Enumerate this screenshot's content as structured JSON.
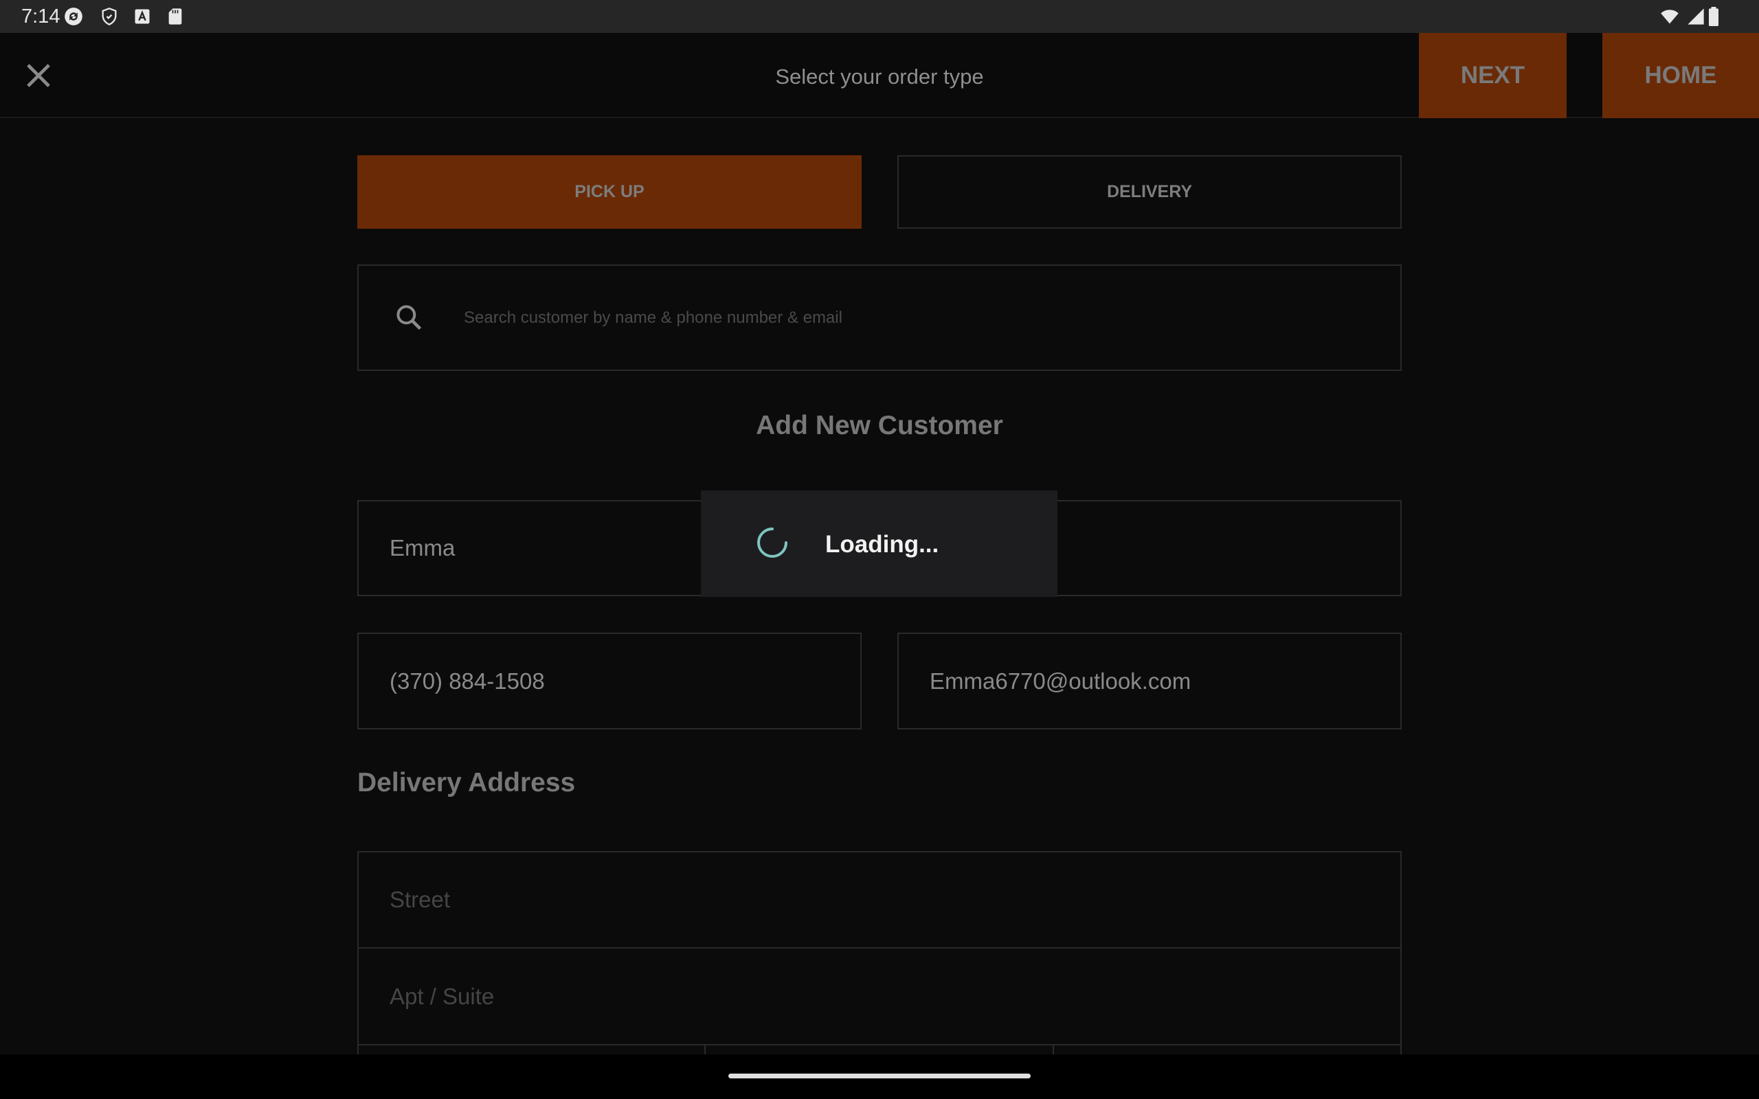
{
  "status_bar": {
    "time": "7:14",
    "left_icons": [
      "sync-icon",
      "shield-icon",
      "font-icon",
      "sd-card-icon"
    ],
    "right_icons": [
      "wifi-icon",
      "cell-signal-icon",
      "battery-icon"
    ]
  },
  "header": {
    "title": "Select your order type",
    "next_label": "NEXT",
    "home_label": "HOME",
    "accent_color": "#6a2a06"
  },
  "order_type": {
    "options": [
      "PICK UP",
      "DELIVERY"
    ],
    "selected": "PICK UP"
  },
  "search": {
    "placeholder": "Search customer by name & phone number & email",
    "value": ""
  },
  "new_customer": {
    "title": "Add New Customer",
    "first_name": "Emma",
    "last_name": "",
    "phone": "(370) 884-1508",
    "email": "Emma6770@outlook.com"
  },
  "delivery_address": {
    "title": "Delivery Address",
    "street_placeholder": "Street",
    "apt_placeholder": "Apt / Suite"
  },
  "loading": {
    "text": "Loading...",
    "spinner_color": "#7fc4c0"
  }
}
